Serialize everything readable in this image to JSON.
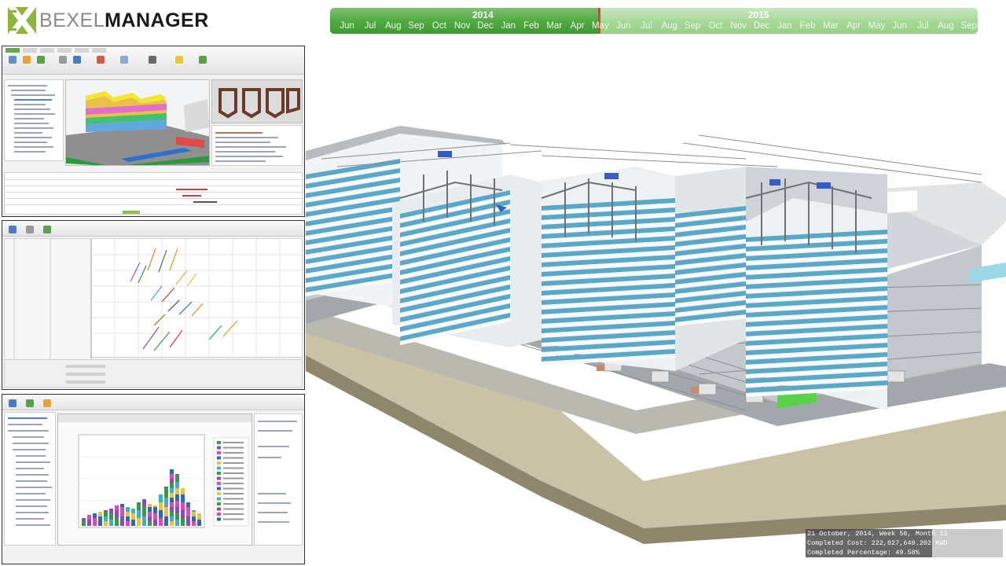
{
  "brand": {
    "part1": "BEXEL",
    "part2": "MANAGER"
  },
  "timeline": {
    "years": [
      {
        "label": "2014"
      },
      {
        "label": "2015"
      }
    ],
    "months": [
      "Jun",
      "Jul",
      "Aug",
      "Sep",
      "Oct",
      "Nov",
      "Dec",
      "Jan",
      "Feb",
      "Mar",
      "Apr",
      "May",
      "Jun",
      "Jul",
      "Aug",
      "Sep",
      "Oct",
      "Nov",
      "Dec",
      "Jan",
      "Feb",
      "Mar",
      "Apr",
      "May",
      "Jun",
      "Jul",
      "Aug",
      "Sep"
    ],
    "progress": 0.415
  },
  "status": {
    "line1": "21 October, 2014, Week 56, Month 13",
    "line2": "Completed Cost: 222,027,649.202 KWD",
    "line3": "Completed Percentage: 49.58%"
  },
  "colors": {
    "timeline_done": "#4ea83f",
    "timeline_remaining": "#a5d895",
    "timeline_marker": "#d9463e"
  }
}
